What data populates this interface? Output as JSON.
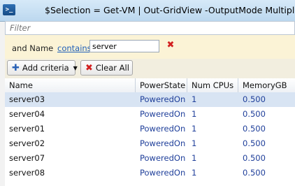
{
  "window": {
    "title": "$Selection = Get-VM | Out-GridView -OutputMode Multiple",
    "icon_name": "powershell-icon",
    "icon_glyph": ">_"
  },
  "filter": {
    "placeholder": "Filter"
  },
  "criteria": {
    "prefix": "and Name",
    "operator": "contains",
    "value": "server",
    "remove_icon": "red-x-icon"
  },
  "toolbar": {
    "add_criteria_label": "Add criteria",
    "clear_all_label": "Clear All"
  },
  "grid": {
    "columns": [
      "Name",
      "PowerState",
      "Num CPUs",
      "MemoryGB"
    ],
    "rows": [
      {
        "name": "server03",
        "power": "PoweredOn",
        "cpus": "1",
        "mem": "0.500",
        "selected": true
      },
      {
        "name": "server04",
        "power": "PoweredOn",
        "cpus": "1",
        "mem": "0.500",
        "selected": false
      },
      {
        "name": "server01",
        "power": "PoweredOn",
        "cpus": "1",
        "mem": "0.500",
        "selected": false
      },
      {
        "name": "server02",
        "power": "PoweredOn",
        "cpus": "1",
        "mem": "0.500",
        "selected": false
      },
      {
        "name": "server07",
        "power": "PoweredOn",
        "cpus": "1",
        "mem": "0.500",
        "selected": false
      },
      {
        "name": "server08",
        "power": "PoweredOn",
        "cpus": "1",
        "mem": "0.500",
        "selected": false
      }
    ]
  },
  "colors": {
    "selected_row": "#d8e4f3",
    "criteria_background": "#fbf3d6",
    "link": "#1f5fb8"
  }
}
